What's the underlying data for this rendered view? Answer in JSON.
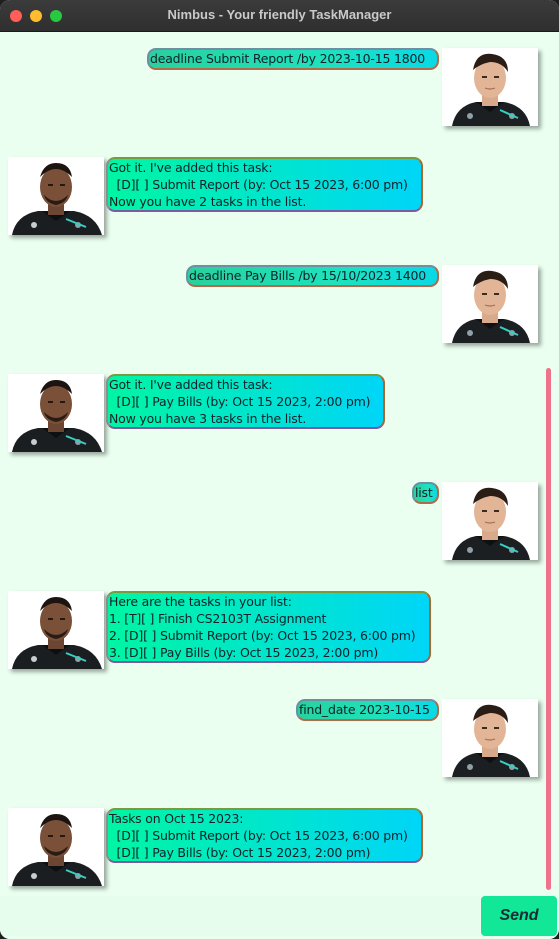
{
  "window": {
    "title": "Nimbus - Your friendly TaskManager"
  },
  "messages": [
    {
      "sender": "user",
      "avatar": "user-avatar-icon",
      "lines": [
        "deadline Submit Report /by 2023-10-15 1800"
      ]
    },
    {
      "sender": "bot",
      "avatar": "bot-avatar-icon",
      "lines": [
        "Got it. I've added this task:",
        "  [D][ ] Submit Report (by: Oct 15 2023, 6:00 pm)",
        "Now you have 2 tasks in the list."
      ]
    },
    {
      "sender": "user",
      "avatar": "user-avatar-icon",
      "lines": [
        "deadline Pay Bills /by 15/10/2023 1400"
      ]
    },
    {
      "sender": "bot",
      "avatar": "bot-avatar-icon",
      "lines": [
        "Got it. I've added this task:",
        "  [D][ ] Pay Bills (by: Oct 15 2023, 2:00 pm)",
        "Now you have 3 tasks in the list."
      ]
    },
    {
      "sender": "user",
      "avatar": "user-avatar-icon",
      "lines": [
        "list"
      ]
    },
    {
      "sender": "bot",
      "avatar": "bot-avatar-icon",
      "lines": [
        "Here are the tasks in your list:",
        "1. [T][ ] Finish CS2103T Assignment",
        "2. [D][ ] Submit Report (by: Oct 15 2023, 6:00 pm)",
        "3. [D][ ] Pay Bills (by: Oct 15 2023, 2:00 pm)"
      ]
    },
    {
      "sender": "user",
      "avatar": "user-avatar-icon",
      "lines": [
        "find_date 2023-10-15"
      ]
    },
    {
      "sender": "bot",
      "avatar": "bot-avatar-icon",
      "lines": [
        "Tasks on Oct 15 2023:",
        "  [D][ ] Submit Report (by: Oct 15 2023, 6:00 pm)",
        "  [D][ ] Pay Bills (by: Oct 15 2023, 2:00 pm)"
      ]
    }
  ],
  "input": {
    "value": "",
    "placeholder": ""
  },
  "send_button": {
    "label": "Send"
  },
  "colors": {
    "background": "#eafff0",
    "scrollbar": "#f0718b",
    "send_button": "#11e796"
  }
}
